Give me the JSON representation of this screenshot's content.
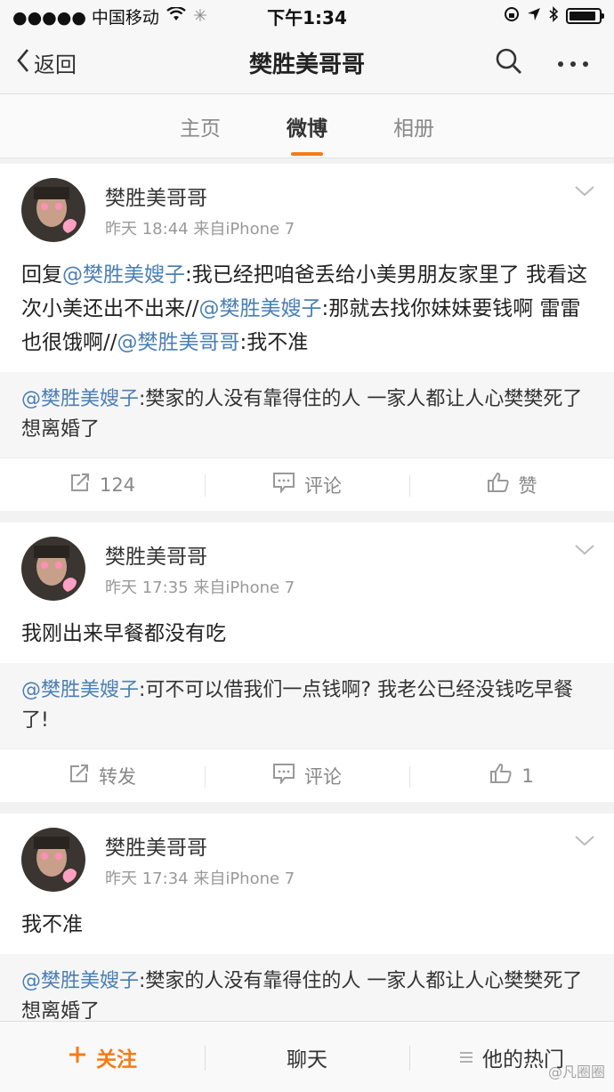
{
  "status_bar": {
    "carrier": "●●●●● 中国移动",
    "time": "下午1:34",
    "battery_level": 0.9
  },
  "nav": {
    "back_label": "返回",
    "title": "樊胜美哥哥"
  },
  "tabs": [
    {
      "label": "主页"
    },
    {
      "label": "微博",
      "active": true
    },
    {
      "label": "相册"
    }
  ],
  "posts": [
    {
      "author": "樊胜美哥哥",
      "meta": "昨天 18:44  来自iPhone 7",
      "text_html": "回复<span class=\"mention\">@樊胜美嫂子</span>:我已经把咱爸丢给小美男朋友家里了 我看这次小美还出不出来//<span class=\"mention\">@樊胜美嫂子</span>:那就去找你妹妹要钱啊 雷雷也很饿啊//<span class=\"mention\">@樊胜美哥哥</span>:我不准",
      "repost_html": "<span class=\"mention\">@樊胜美嫂子</span>:樊家的人没有靠得住的人 一家人都让人心樊樊死了 想离婚了",
      "actions": {
        "repost": "124",
        "comment": "评论",
        "like": "赞"
      }
    },
    {
      "author": "樊胜美哥哥",
      "meta": "昨天 17:35  来自iPhone 7",
      "text_html": "我刚出来早餐都没有吃",
      "repost_html": "<span class=\"mention\">@樊胜美嫂子</span>:可不可以借我们一点钱啊? 我老公已经没钱吃早餐了!",
      "actions": {
        "repost": "转发",
        "comment": "评论",
        "like": "1"
      }
    },
    {
      "author": "樊胜美哥哥",
      "meta": "昨天 17:34  来自iPhone 7",
      "text_html": "我不准",
      "repost_html": "<span class=\"mention\">@樊胜美嫂子</span>:樊家的人没有靠得住的人 一家人都让人心樊樊死了 想离婚了",
      "actions": {
        "repost": "",
        "comment": "",
        "like": ""
      }
    }
  ],
  "bottom_bar": {
    "follow": "关注",
    "chat": "聊天",
    "hot": "他的热门"
  },
  "watermark": "@凡圈圈",
  "colors": {
    "accent": "#f77b14",
    "mention": "#4a7fb5"
  }
}
